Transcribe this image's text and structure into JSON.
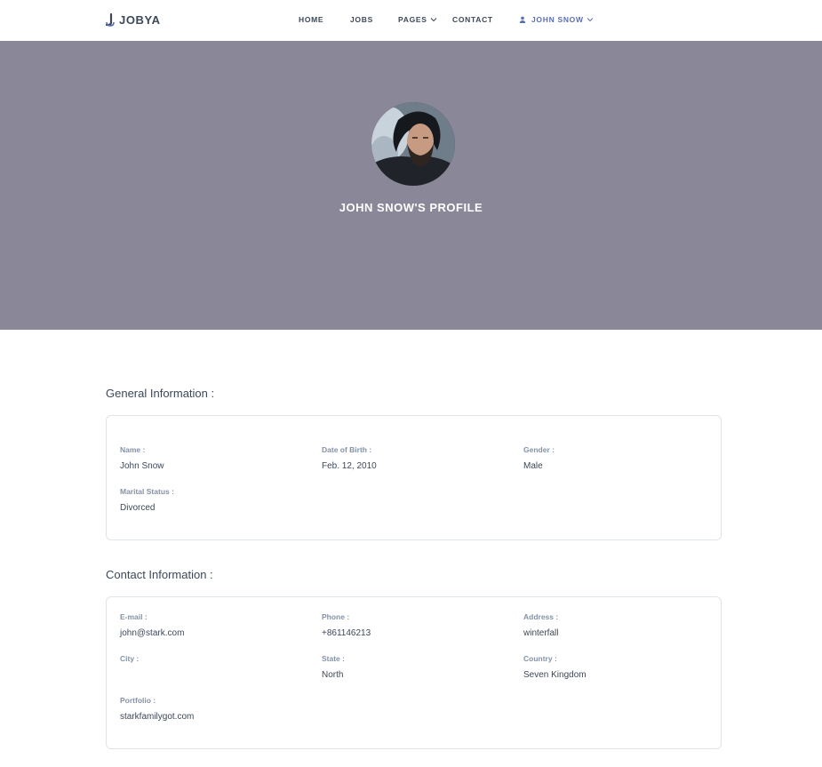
{
  "header": {
    "logo_text": "JOBYA",
    "nav": [
      {
        "label": "HOME"
      },
      {
        "label": "JOBS"
      },
      {
        "label": "PAGES"
      },
      {
        "label": "CONTACT"
      }
    ],
    "user_menu_label": "JOHN SNOW"
  },
  "hero": {
    "title": "JOHN SNOW'S PROFILE"
  },
  "general": {
    "title": "General Information :",
    "fields": [
      {
        "label": "Name :",
        "value": "John Snow"
      },
      {
        "label": "Date of Birth :",
        "value": "Feb. 12, 2010"
      },
      {
        "label": "Gender :",
        "value": "Male"
      },
      {
        "label": "Marital Status :",
        "value": "Divorced"
      }
    ]
  },
  "contact": {
    "title": "Contact Information :",
    "fields": [
      {
        "label": "E-mail :",
        "value": "john@stark.com"
      },
      {
        "label": "Phone :",
        "value": "+861146213"
      },
      {
        "label": "Address :",
        "value": "winterfall"
      },
      {
        "label": "City :",
        "value": ""
      },
      {
        "label": "State :",
        "value": "North"
      },
      {
        "label": "Country :",
        "value": "Seven Kingdom"
      },
      {
        "label": "Portfolio :",
        "value": "starkfamilygot.com"
      }
    ]
  },
  "colors": {
    "hero_bg": "#8a8798",
    "accent": "#5a6fb8",
    "text": "#3c4858",
    "label": "#8492a6"
  },
  "icons": [
    "logo-icon",
    "chevron-down-icon",
    "user-icon"
  ]
}
